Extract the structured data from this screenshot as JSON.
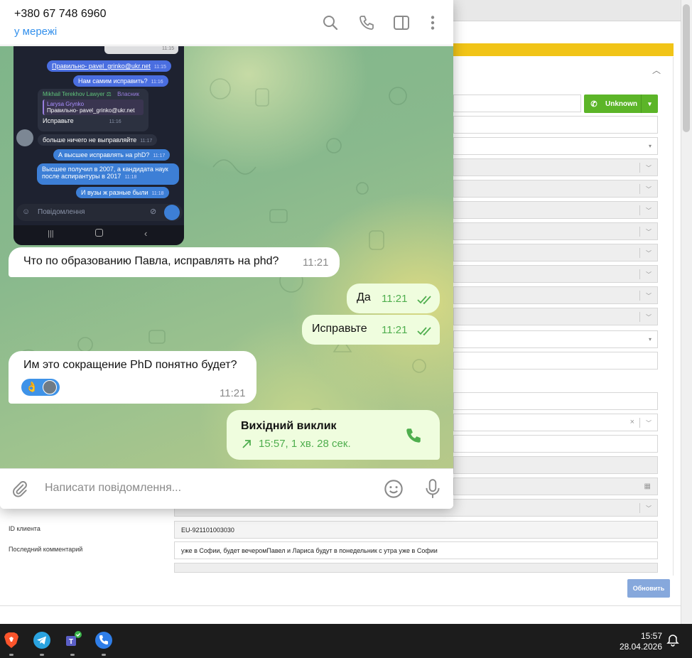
{
  "telegram": {
    "contact_name": "+380 67 748 6960",
    "status": "у мережі",
    "composer_placeholder": "Написати повідомлення...",
    "phone_screenshot": {
      "messages": [
        {
          "text": "Правильно- pavel_grinko@ukr.net",
          "time": "11:15"
        },
        {
          "text": "Нам самим исправить?",
          "time": "11:16"
        },
        {
          "sender": "Mikhail Terekhov Lawyer",
          "role": "Власник",
          "reply_name": "Larysa Grynko",
          "reply_text": "Правильно- pavel_grinko@ukr.net",
          "text": "Исправьте",
          "time": "11:16"
        },
        {
          "text": "больше ничего не выправляйте",
          "time": "11:17"
        },
        {
          "text": "А высшее исправлять на phD?",
          "time": "11:17"
        },
        {
          "text": "Высшее получил в 2007, а кандидата наук после аспирантуры в 2017",
          "time": "11:18"
        },
        {
          "text": "И вузы ж разные были",
          "time": "11:18"
        }
      ],
      "top_time": "11:15",
      "input_placeholder": "Повідомлення"
    },
    "messages": [
      {
        "text": "Что по образованию Павла, исправлять на phd?",
        "time": "11:21"
      },
      {
        "text": "Да",
        "time": "11:21"
      },
      {
        "text": "Исправьте",
        "time": "11:21"
      },
      {
        "text": "Им это сокращение PhD понятно будет?",
        "time": "11:21"
      }
    ],
    "reaction_emoji": "👌",
    "call": {
      "title": "Вихідний виклик",
      "detail": "15:57, 1 хв. 28 сек."
    }
  },
  "crm": {
    "call_button": "Unknown",
    "rows": [
      {
        "label": "ID клиента",
        "value": "EU-921101003030"
      },
      {
        "label": "Последний комментарий",
        "value": "уже в Софии, будет вечеромПавел и Лариса будут в понедельник с утра уже в Софии"
      }
    ],
    "update_button": "Обновить"
  },
  "taskbar": {
    "time": "15:57",
    "date": "28.04.2026",
    "apps": [
      "brave-icon",
      "telegram-icon",
      "teams-icon",
      "phone-app-icon"
    ]
  },
  "colors": {
    "accent_blue": "#3390ec",
    "bubble_out": "#effdde",
    "check_green": "#4fae4e",
    "crm_green": "#5cb528",
    "crm_yellow": "#f1c417",
    "update_button": "#86a8dc"
  }
}
